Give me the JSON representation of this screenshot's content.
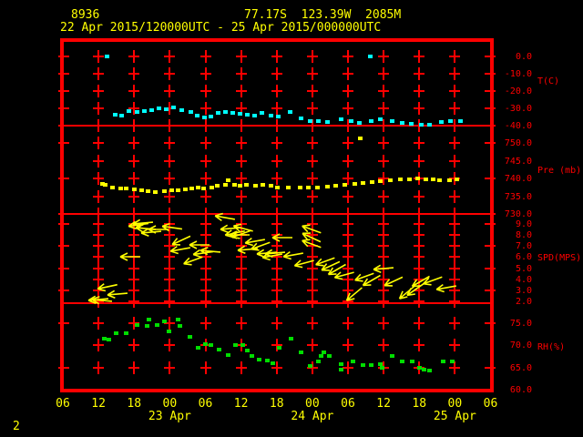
{
  "header": {
    "station_id": "8936",
    "location": "77.17S  123.39W  2085M",
    "time_range": "22 Apr 2015/120000UTC - 25 Apr 2015/000000UTC"
  },
  "footer": {
    "page_indicator": "2"
  },
  "colors": {
    "background": "#000000",
    "frame": "#ff0000",
    "axis_text": "#ff0000",
    "time_text": "#ffff00",
    "temperature": "#00ffff",
    "pressure": "#ffff00",
    "wind": "#ffff00",
    "rh": "#00dd00"
  },
  "x_axis": {
    "unit": "hours UTC (hours since 22 Apr 2015 00UTC)",
    "xlim_hours": [
      6,
      78
    ],
    "ticks": [
      {
        "hour": 6,
        "label": "06"
      },
      {
        "hour": 12,
        "label": "12"
      },
      {
        "hour": 18,
        "label": "18"
      },
      {
        "hour": 24,
        "label": "00"
      },
      {
        "hour": 30,
        "label": "06"
      },
      {
        "hour": 36,
        "label": "12"
      },
      {
        "hour": 42,
        "label": "18"
      },
      {
        "hour": 48,
        "label": "00"
      },
      {
        "hour": 54,
        "label": "06"
      },
      {
        "hour": 60,
        "label": "12"
      },
      {
        "hour": 66,
        "label": "18"
      },
      {
        "hour": 72,
        "label": "00"
      },
      {
        "hour": 78,
        "label": "06"
      }
    ],
    "dates": [
      {
        "hour": 24,
        "label": "23 Apr"
      },
      {
        "hour": 48,
        "label": "24 Apr"
      },
      {
        "hour": 72,
        "label": "25 Apr"
      }
    ]
  },
  "chart_data": {
    "type": "scatter",
    "description": "Station meteogram: four stacked panels (temperature, pressure, wind speed/direction arrows, relative humidity) vs time",
    "x_unit": "hours since 22 Apr 2015 00UTC",
    "xlim_hours": [
      6,
      78
    ],
    "panels": [
      {
        "id": "temperature",
        "unit_label": "T(C)",
        "edge_ticks": [
          0,
          -10,
          -20,
          -30,
          -40
        ],
        "ticks": [
          {
            "value": 0,
            "label": "0.0"
          },
          {
            "value": -10,
            "label": "-10.0"
          },
          {
            "value": -20,
            "label": "-20.0"
          },
          {
            "value": -30,
            "label": "-30.0"
          },
          {
            "value": -40,
            "label": "-40.0"
          }
        ]
      },
      {
        "id": "pressure",
        "unit_label": "Pre (mb)",
        "edge_ticks": [
          750,
          740,
          730
        ],
        "ticks": [
          {
            "value": 750,
            "label": "750.0"
          },
          {
            "value": 745,
            "label": "745.0"
          },
          {
            "value": 740,
            "label": "740.0"
          },
          {
            "value": 735,
            "label": "735.0"
          },
          {
            "value": 730,
            "label": "730.0"
          }
        ]
      },
      {
        "id": "wind",
        "unit_label": "SPD(MPS)",
        "edge_ticks": [
          9,
          7,
          5,
          3
        ],
        "ticks": [
          {
            "value": 9,
            "label": "9.0"
          },
          {
            "value": 8,
            "label": "8.0"
          },
          {
            "value": 7,
            "label": "7.0"
          },
          {
            "value": 6,
            "label": "6.0"
          },
          {
            "value": 5,
            "label": "5.0"
          },
          {
            "value": 4,
            "label": "4.0"
          },
          {
            "value": 3,
            "label": "3.0"
          },
          {
            "value": 2,
            "label": "2.0"
          }
        ]
      },
      {
        "id": "rh",
        "unit_label": "RH(%)",
        "edge_ticks": [
          75,
          65
        ],
        "ticks": [
          {
            "value": 75,
            "label": "75.0"
          },
          {
            "value": 70,
            "label": "70.0"
          },
          {
            "value": 65,
            "label": "65.0"
          },
          {
            "value": 60,
            "label": "60.0"
          }
        ]
      }
    ],
    "series": [
      {
        "name": "temperature",
        "panel": "temperature",
        "style": "dots",
        "color": "#00ffff",
        "points": [
          [
            13.4,
            0.0
          ],
          [
            14.8,
            -33.7
          ],
          [
            15.8,
            -34.2
          ],
          [
            17.1,
            -31.6
          ],
          [
            18.4,
            -32.1
          ],
          [
            19.7,
            -31.6
          ],
          [
            20.9,
            -31.1
          ],
          [
            22.1,
            -30.0
          ],
          [
            23.3,
            -30.5
          ],
          [
            24.6,
            -29.5
          ],
          [
            26.0,
            -31.1
          ],
          [
            27.5,
            -32.1
          ],
          [
            28.6,
            -34.2
          ],
          [
            29.8,
            -35.3
          ],
          [
            30.9,
            -34.7
          ],
          [
            32.1,
            -32.6
          ],
          [
            33.3,
            -32.1
          ],
          [
            34.6,
            -32.6
          ],
          [
            35.8,
            -33.2
          ],
          [
            37.0,
            -33.7
          ],
          [
            38.2,
            -34.2
          ],
          [
            39.5,
            -32.6
          ],
          [
            41.0,
            -34.2
          ],
          [
            42.2,
            -34.7
          ],
          [
            44.2,
            -32.1
          ],
          [
            46.1,
            -35.8
          ],
          [
            47.6,
            -37.4
          ],
          [
            49.0,
            -37.4
          ],
          [
            50.4,
            -37.9
          ],
          [
            52.7,
            -36.3
          ],
          [
            54.4,
            -37.4
          ],
          [
            55.9,
            -38.4
          ],
          [
            57.7,
            0.0
          ],
          [
            57.9,
            -37.4
          ],
          [
            59.4,
            -36.3
          ],
          [
            61.3,
            -37.4
          ],
          [
            63.0,
            -38.4
          ],
          [
            64.6,
            -38.9
          ],
          [
            66.3,
            -39.5
          ],
          [
            67.6,
            -39.5
          ],
          [
            69.6,
            -37.9
          ],
          [
            71.2,
            -37.4
          ],
          [
            72.9,
            -37.4
          ]
        ]
      },
      {
        "name": "pressure",
        "panel": "pressure",
        "style": "dots",
        "color": "#ffff00",
        "points": [
          [
            12.6,
            738.5
          ],
          [
            13.1,
            738.2
          ],
          [
            14.3,
            737.4
          ],
          [
            15.7,
            737.2
          ],
          [
            16.6,
            737.2
          ],
          [
            18.0,
            736.9
          ],
          [
            19.2,
            736.7
          ],
          [
            20.3,
            736.4
          ],
          [
            21.5,
            736.2
          ],
          [
            23.0,
            736.4
          ],
          [
            24.3,
            736.7
          ],
          [
            25.3,
            736.7
          ],
          [
            26.6,
            736.9
          ],
          [
            27.6,
            737.2
          ],
          [
            28.7,
            737.4
          ],
          [
            29.6,
            737.2
          ],
          [
            31.0,
            737.4
          ],
          [
            31.9,
            737.9
          ],
          [
            33.3,
            738.2
          ],
          [
            33.8,
            739.5
          ],
          [
            34.9,
            738.2
          ],
          [
            35.8,
            737.9
          ],
          [
            36.9,
            738.2
          ],
          [
            38.4,
            737.9
          ],
          [
            39.6,
            738.2
          ],
          [
            41.0,
            737.9
          ],
          [
            42.1,
            737.4
          ],
          [
            43.9,
            737.4
          ],
          [
            45.8,
            737.4
          ],
          [
            47.3,
            737.4
          ],
          [
            48.8,
            737.4
          ],
          [
            50.4,
            737.7
          ],
          [
            51.9,
            737.9
          ],
          [
            53.4,
            738.2
          ],
          [
            55.0,
            738.5
          ],
          [
            56.0,
            751.3
          ],
          [
            56.5,
            738.7
          ],
          [
            58.0,
            739.0
          ],
          [
            59.4,
            739.2
          ],
          [
            61.1,
            739.5
          ],
          [
            62.7,
            739.7
          ],
          [
            64.3,
            739.7
          ],
          [
            65.7,
            740.0
          ],
          [
            67.0,
            739.7
          ],
          [
            68.2,
            739.7
          ],
          [
            69.4,
            739.5
          ],
          [
            71.0,
            739.5
          ],
          [
            72.2,
            739.7
          ]
        ]
      },
      {
        "name": "wind",
        "panel": "wind",
        "style": "arrows",
        "color": "#ffff00",
        "point_format": "[hour, speed_mps, arrow_tilt_deg (0 = pointing left, + = head up)]",
        "points": [
          [
            12.0,
            2.2,
            -5
          ],
          [
            12.6,
            2.1,
            5
          ],
          [
            13.5,
            3.3,
            -12
          ],
          [
            15.2,
            2.7,
            -5
          ],
          [
            17.4,
            6.0,
            0
          ],
          [
            18.7,
            8.9,
            -8
          ],
          [
            19.5,
            9.1,
            -5
          ],
          [
            20.0,
            8.6,
            5
          ],
          [
            20.9,
            8.3,
            -5
          ],
          [
            22.1,
            8.5,
            0
          ],
          [
            24.4,
            8.7,
            8
          ],
          [
            25.8,
            6.7,
            -10
          ],
          [
            26.0,
            7.5,
            -25
          ],
          [
            28.0,
            5.7,
            -20
          ],
          [
            29.0,
            7.1,
            0
          ],
          [
            29.6,
            6.4,
            -8
          ],
          [
            30.9,
            6.5,
            5
          ],
          [
            33.3,
            9.6,
            10
          ],
          [
            34.2,
            8.6,
            -5
          ],
          [
            35.0,
            8.2,
            -12
          ],
          [
            35.8,
            8.0,
            0
          ],
          [
            36.1,
            8.1,
            -20
          ],
          [
            36.4,
            8.6,
            15
          ],
          [
            37.2,
            6.7,
            -5
          ],
          [
            38.4,
            7.4,
            -10
          ],
          [
            39.3,
            7.0,
            -20
          ],
          [
            40.4,
            6.4,
            -5
          ],
          [
            41.3,
            6.1,
            -10
          ],
          [
            41.8,
            6.4,
            -5
          ],
          [
            43.0,
            7.8,
            0
          ],
          [
            44.8,
            6.2,
            -10
          ],
          [
            46.7,
            5.5,
            -15
          ],
          [
            47.8,
            8.5,
            20
          ],
          [
            47.8,
            7.8,
            25
          ],
          [
            47.9,
            7.2,
            20
          ],
          [
            50.2,
            5.6,
            -20
          ],
          [
            51.1,
            5.2,
            -25
          ],
          [
            52.2,
            4.9,
            -30
          ],
          [
            53.4,
            4.4,
            -15
          ],
          [
            55.0,
            2.7,
            -40
          ],
          [
            56.8,
            4.2,
            -20
          ],
          [
            58.0,
            3.9,
            -30
          ],
          [
            60.0,
            5.0,
            -5
          ],
          [
            61.7,
            3.8,
            -25
          ],
          [
            63.9,
            2.8,
            -40
          ],
          [
            65.3,
            3.1,
            -35
          ],
          [
            66.2,
            3.8,
            -30
          ],
          [
            68.3,
            3.9,
            -20
          ],
          [
            70.5,
            3.2,
            -10
          ]
        ]
      },
      {
        "name": "rh",
        "panel": "rh",
        "style": "dots",
        "color": "#00dd00",
        "points": [
          [
            12.9,
            71.5
          ],
          [
            13.7,
            71.3
          ],
          [
            14.9,
            72.7
          ],
          [
            16.6,
            72.7
          ],
          [
            18.4,
            74.6
          ],
          [
            20.1,
            74.4
          ],
          [
            20.4,
            75.8
          ],
          [
            21.8,
            74.6
          ],
          [
            23.0,
            75.4
          ],
          [
            23.8,
            73.2
          ],
          [
            25.3,
            75.8
          ],
          [
            25.7,
            74.4
          ],
          [
            27.3,
            71.9
          ],
          [
            28.7,
            69.5
          ],
          [
            29.9,
            70.3
          ],
          [
            30.9,
            70.1
          ],
          [
            32.2,
            69.0
          ],
          [
            33.8,
            67.8
          ],
          [
            35.0,
            70.1
          ],
          [
            36.2,
            70.1
          ],
          [
            37.0,
            68.8
          ],
          [
            37.8,
            67.6
          ],
          [
            39.0,
            66.8
          ],
          [
            40.4,
            66.6
          ],
          [
            41.2,
            66.0
          ],
          [
            42.4,
            69.5
          ],
          [
            44.4,
            71.5
          ],
          [
            46.1,
            68.4
          ],
          [
            47.6,
            65.3
          ],
          [
            49.0,
            66.4
          ],
          [
            49.4,
            67.6
          ],
          [
            49.8,
            68.4
          ],
          [
            50.8,
            67.6
          ],
          [
            52.7,
            65.8
          ],
          [
            52.8,
            64.5
          ],
          [
            54.7,
            66.4
          ],
          [
            56.4,
            65.6
          ],
          [
            57.9,
            65.6
          ],
          [
            59.4,
            65.8
          ],
          [
            59.6,
            64.9
          ],
          [
            61.4,
            67.6
          ],
          [
            63.0,
            66.4
          ],
          [
            64.8,
            66.4
          ],
          [
            66.0,
            64.9
          ],
          [
            66.8,
            64.5
          ],
          [
            67.7,
            64.3
          ],
          [
            70.0,
            66.4
          ],
          [
            71.5,
            66.4
          ]
        ]
      }
    ]
  }
}
